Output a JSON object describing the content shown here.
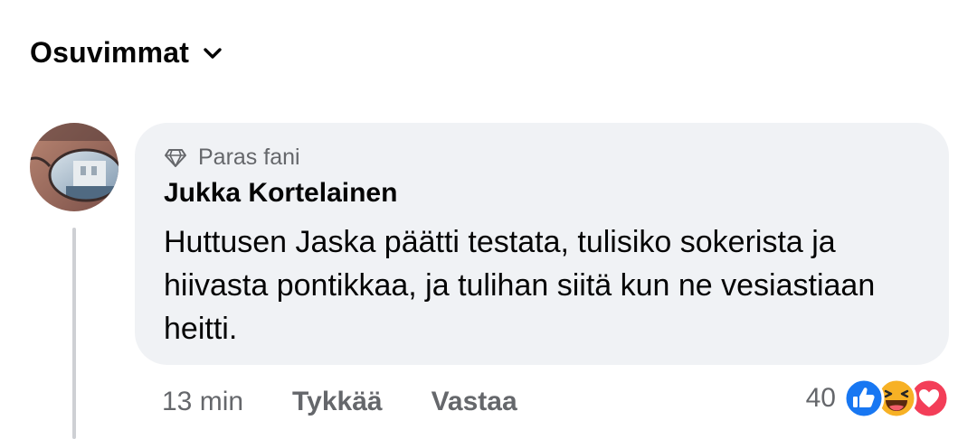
{
  "sort": {
    "label": "Osuvimmat",
    "icon": "chevron-down-icon"
  },
  "comment": {
    "avatar": "profile-photo",
    "badge": {
      "icon": "diamond-icon",
      "label": "Paras fani"
    },
    "author": "Jukka Kortelainen",
    "text": "Huttusen Jaska päätti testata, tulisiko sokerista ja hiivasta pontikkaa, ja tulihan siitä kun ne vesiastiaan heitti.",
    "time": "13 min",
    "like_label": "Tykkää",
    "reply_label": "Vastaa",
    "reaction_count": "40",
    "reactions": [
      "like-icon",
      "haha-icon",
      "love-icon"
    ]
  },
  "colors": {
    "text": "#050505",
    "secondary": "#65676b",
    "bubble": "#f0f2f5",
    "like_blue": "#1877f2",
    "haha_yellow": "#f7b125",
    "love_red": "#f33e58"
  }
}
